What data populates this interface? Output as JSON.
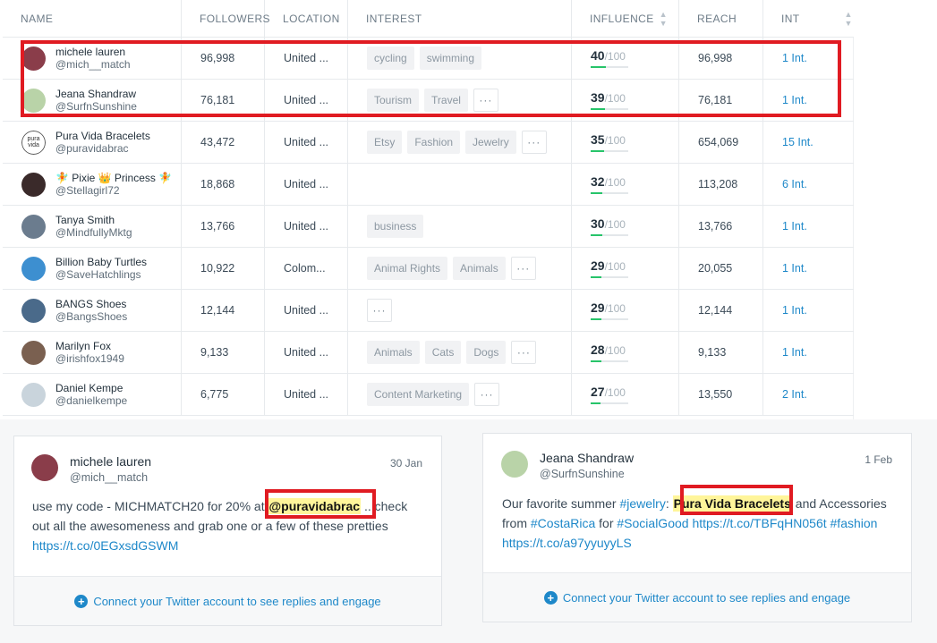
{
  "columns": {
    "name": "NAME",
    "followers": "FOLLOWERS",
    "location": "LOCATION",
    "interest": "INTEREST",
    "influence": "INFLUENCE",
    "reach": "REACH",
    "int": "INT"
  },
  "rows": [
    {
      "name": "michele lauren",
      "handle": "@mich__match",
      "followers": "96,998",
      "location": "United ...",
      "tags": [
        "cycling",
        "swimming"
      ],
      "more": false,
      "influence": "40",
      "influence_max": "/100",
      "influence_level": 0.4,
      "reach": "96,998",
      "interactions": "1 Int.",
      "avatar_color": "#8a3d4a"
    },
    {
      "name": "Jeana Shandraw",
      "handle": "@SurfnSunshine",
      "followers": "76,181",
      "location": "United ...",
      "tags": [
        "Tourism",
        "Travel"
      ],
      "more": true,
      "influence": "39",
      "influence_max": "/100",
      "influence_level": 0.39,
      "reach": "76,181",
      "interactions": "1 Int.",
      "avatar_color": "#b9d3a8"
    },
    {
      "name": "Pura Vida Bracelets",
      "handle": "@puravidabrac",
      "followers": "43,472",
      "location": "United ...",
      "tags": [
        "Etsy",
        "Fashion",
        "Jewelry"
      ],
      "more": true,
      "influence": "35",
      "influence_max": "/100",
      "influence_level": 0.35,
      "reach": "654,069",
      "interactions": "15 Int.",
      "avatar_color": "#ffffff",
      "avatar_text": "pura vida"
    },
    {
      "name": "🧚 Pixie 👑 Princess 🧚",
      "handle": "@Stellagirl72",
      "followers": "18,868",
      "location": "United ...",
      "tags": [],
      "more": false,
      "influence": "32",
      "influence_max": "/100",
      "influence_level": 0.32,
      "reach": "113,208",
      "interactions": "6 Int.",
      "avatar_color": "#3a2a2a"
    },
    {
      "name": "Tanya Smith",
      "handle": "@MindfullyMktg",
      "followers": "13,766",
      "location": "United ...",
      "tags": [
        "business"
      ],
      "more": false,
      "influence": "30",
      "influence_max": "/100",
      "influence_level": 0.3,
      "reach": "13,766",
      "interactions": "1 Int.",
      "avatar_color": "#6b7c8e"
    },
    {
      "name": "Billion Baby Turtles",
      "handle": "@SaveHatchlings",
      "followers": "10,922",
      "location": "Colom...",
      "tags": [
        "Animal Rights",
        "Animals"
      ],
      "more": true,
      "influence": "29",
      "influence_max": "/100",
      "influence_level": 0.29,
      "reach": "20,055",
      "interactions": "1 Int.",
      "avatar_color": "#3d8fd0"
    },
    {
      "name": "BANGS Shoes",
      "handle": "@BangsShoes",
      "followers": "12,144",
      "location": "United ...",
      "tags": [],
      "more": true,
      "influence": "29",
      "influence_max": "/100",
      "influence_level": 0.29,
      "reach": "12,144",
      "interactions": "1 Int.",
      "avatar_color": "#4a6a8a"
    },
    {
      "name": "Marilyn Fox",
      "handle": "@irishfox1949",
      "followers": "9,133",
      "location": "United ...",
      "tags": [
        "Animals",
        "Cats",
        "Dogs"
      ],
      "more": true,
      "influence": "28",
      "influence_max": "/100",
      "influence_level": 0.28,
      "reach": "9,133",
      "interactions": "1 Int.",
      "avatar_color": "#7a6050"
    },
    {
      "name": "Daniel Kempe",
      "handle": "@danielkempe",
      "followers": "6,775",
      "location": "United ...",
      "tags": [
        "Content Marketing"
      ],
      "more": true,
      "influence": "27",
      "influence_max": "/100",
      "influence_level": 0.27,
      "reach": "13,550",
      "interactions": "2 Int.",
      "avatar_color": "#c9d4dc"
    }
  ],
  "more_label": "···",
  "tweets": [
    {
      "name": "michele lauren",
      "handle": "@mich__match",
      "date": "30 Jan",
      "text_1": "use my code - MICHMATCH20 for 20% at ",
      "highlight": "@puravidabrac",
      "text_2": " ...check out all the awesomeness and grab one or a few of these pretties ",
      "link": "https://t.co/0EGxsdGSWM",
      "footer": "Connect your Twitter account to see replies and engage"
    },
    {
      "name": "Jeana Shandraw",
      "handle": "@SurfnSunshine",
      "date": "1 Feb",
      "text_1": "Our favorite summer ",
      "hash_1": "#jewelry",
      "text_2": ": ",
      "highlight": "Pura Vida Bracelets",
      "text_3": " and Accessories from ",
      "hash_2": "#CostaRica",
      "text_4": " for ",
      "hash_3": "#SocialGood",
      "text_5": " ",
      "link_1": "https://t.co/TBFqHN056t",
      "text_6": " ",
      "hash_4": "#fashion",
      "text_7": " ",
      "link_2": "https://t.co/a97yyuyyLS",
      "footer": "Connect your Twitter account to see replies and engage"
    }
  ],
  "colors": {
    "accent": "#1e88c9",
    "highlight_box": "#e01b22",
    "influence_bar": "#27c46a"
  }
}
